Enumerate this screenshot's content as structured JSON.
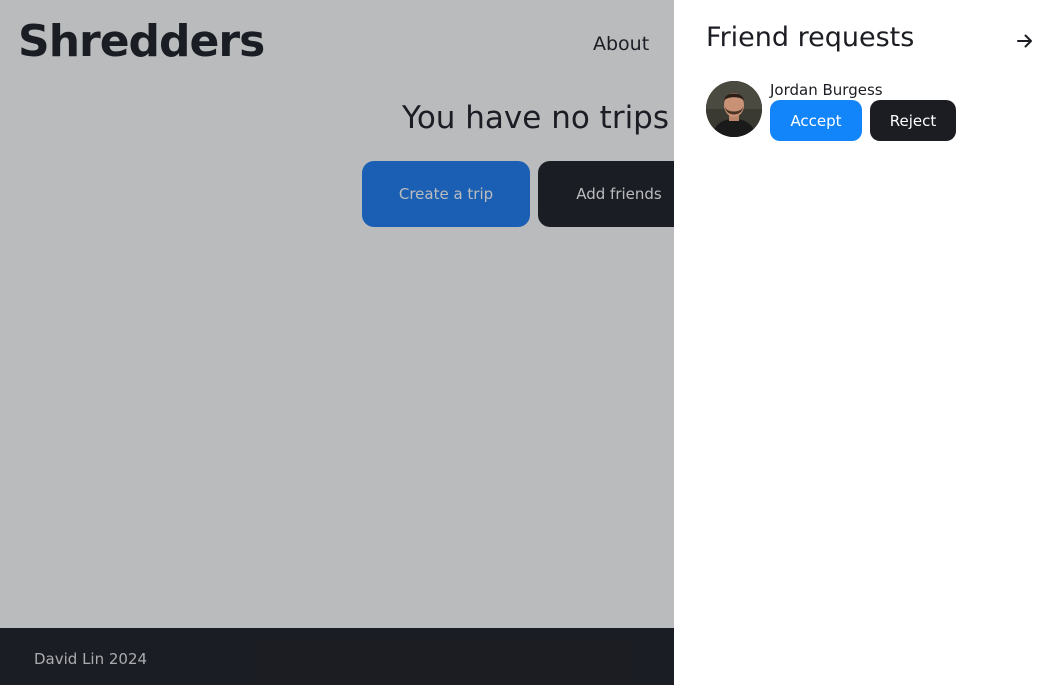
{
  "brand": {
    "logo": "Shredders"
  },
  "nav": {
    "about": "About"
  },
  "hero": {
    "title": "You have no trips",
    "create_label": "Create a trip",
    "add_friends_label": "Add friends"
  },
  "footer": {
    "text": "David Lin 2024"
  },
  "drawer": {
    "title": "Friend requests",
    "close_icon": "arrow-right-icon",
    "requests": [
      {
        "name": "Jordan Burgess",
        "avatar_icon": "avatar-photo",
        "accept_label": "Accept",
        "reject_label": "Reject"
      }
    ]
  },
  "colors": {
    "primary": "#1a7bf2",
    "accept": "#1385fb",
    "dark": "#1b1d23",
    "overlay": "rgba(27,29,35,0.30)"
  }
}
